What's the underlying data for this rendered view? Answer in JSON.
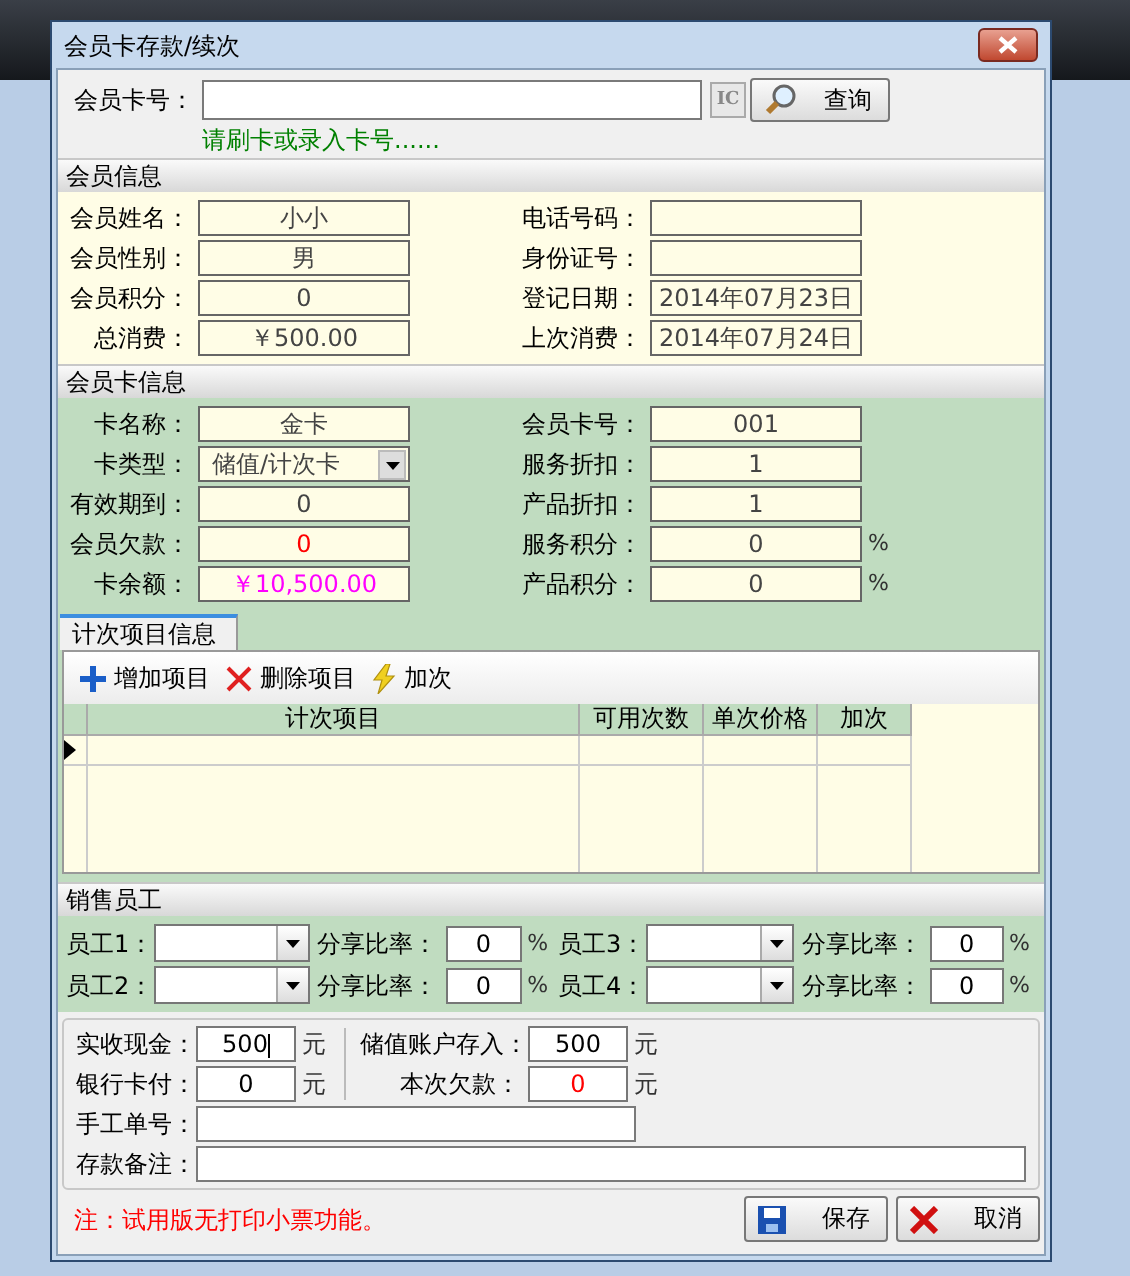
{
  "window": {
    "title": "会员卡存款/续次"
  },
  "card_lookup": {
    "label": "会员卡号：",
    "hint": "请刷卡或录入卡号......",
    "ic_button": "IC",
    "search_button": "查询"
  },
  "member_info": {
    "title": "会员信息",
    "fields": [
      {
        "label": "会员姓名：",
        "value": "小小"
      },
      {
        "label": "电话号码："
      },
      {
        "label": "会员性别：",
        "value": "男"
      },
      {
        "label": "身份证号："
      },
      {
        "label": "会员积分：",
        "value": "0"
      },
      {
        "label": "登记日期：",
        "value": "2014年07月23日"
      },
      {
        "label": "总消费：",
        "value": "￥500.00"
      },
      {
        "label": "上次消费：",
        "value": "2014年07月24日"
      }
    ]
  },
  "card_info": {
    "title": "会员卡信息",
    "fields": [
      {
        "label": "卡名称：",
        "value": "金卡",
        "kind": "text"
      },
      {
        "label": "会员卡号：",
        "value": "001",
        "kind": "text"
      },
      {
        "label": "卡类型：",
        "value": "储值/计次卡",
        "kind": "select"
      },
      {
        "label": "服务折扣：",
        "value": "1",
        "kind": "text"
      },
      {
        "label": "有效期到：",
        "value": "0",
        "kind": "text"
      },
      {
        "label": "产品折扣：",
        "value": "1",
        "kind": "text"
      },
      {
        "label": "会员欠款：",
        "value": "0",
        "kind": "text",
        "color": "#ff0000"
      },
      {
        "label": "服务积分：",
        "value": "0",
        "kind": "text",
        "unit": "%"
      },
      {
        "label": "卡余额：",
        "value": "￥10,500.00",
        "kind": "text",
        "color": "#ff00ff"
      },
      {
        "label": "产品积分：",
        "value": "0",
        "kind": "text",
        "unit": "%"
      }
    ]
  },
  "tabs": [
    {
      "label": "计次项目信息",
      "selected": true
    }
  ],
  "toolbar": [
    {
      "label": "增加项目",
      "kind": "add"
    },
    {
      "label": "删除项目",
      "kind": "delete"
    },
    {
      "label": "加次",
      "kind": "bolt"
    }
  ],
  "table": {
    "columns": [
      "计次项目",
      "可用次数",
      "单次价格",
      "加次"
    ]
  },
  "staff": {
    "title": "销售员工",
    "items": [
      {
        "label": "员工1：",
        "rate_label": "分享比率：",
        "rate": "0",
        "unit": "%"
      },
      {
        "label": "员工3：",
        "rate_label": "分享比率：",
        "rate": "0",
        "unit": "%"
      },
      {
        "label": "员工2：",
        "rate_label": "分享比率：",
        "rate": "0",
        "unit": "%"
      },
      {
        "label": "员工4：",
        "rate_label": "分享比率：",
        "rate": "0",
        "unit": "%"
      }
    ]
  },
  "payment": {
    "amounts": [
      {
        "label": "实收现金：",
        "value": "500",
        "unit": "元",
        "focused": true
      },
      {
        "label": "储值账户存入：",
        "value": "500",
        "unit": "元",
        "focused": false
      },
      {
        "label": "银行卡付：",
        "value": "0",
        "unit": "元",
        "focused": false
      },
      {
        "label": "本次欠款：",
        "value": "0",
        "unit": "元",
        "focused": false,
        "color": "#ff0000"
      }
    ],
    "manual_no": {
      "label": "手工单号："
    },
    "remark": {
      "label": "存款备注："
    }
  },
  "footer": {
    "note": "注：试用版无打印小票功能。",
    "buttons": [
      {
        "label": "保存",
        "kind": "save"
      },
      {
        "label": "取消",
        "kind": "cancel"
      }
    ]
  }
}
